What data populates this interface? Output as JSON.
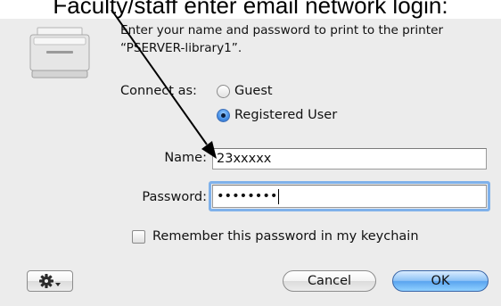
{
  "caption": "Faculty/staff enter email network login:",
  "dialog": {
    "message": "Enter your name and password to print to the printer “PSERVER-library1”.",
    "connect_as_label": "Connect as:",
    "radio_options": [
      {
        "label": "Guest",
        "checked": false
      },
      {
        "label": "Registered User",
        "checked": true
      }
    ],
    "name_label": "Name:",
    "name_value": "23xxxxx",
    "password_label": "Password:",
    "password_value": "••••••••",
    "remember_label": "Remember this password in my keychain",
    "remember_checked": false,
    "cancel_label": "Cancel",
    "ok_label": "OK",
    "action_icon": "gear-menu-icon",
    "printer_icon": "printer-icon"
  },
  "colors": {
    "window_bg": "#ececec",
    "default_button": "#5aa4ef",
    "focus_ring": "#7fb1ea"
  }
}
